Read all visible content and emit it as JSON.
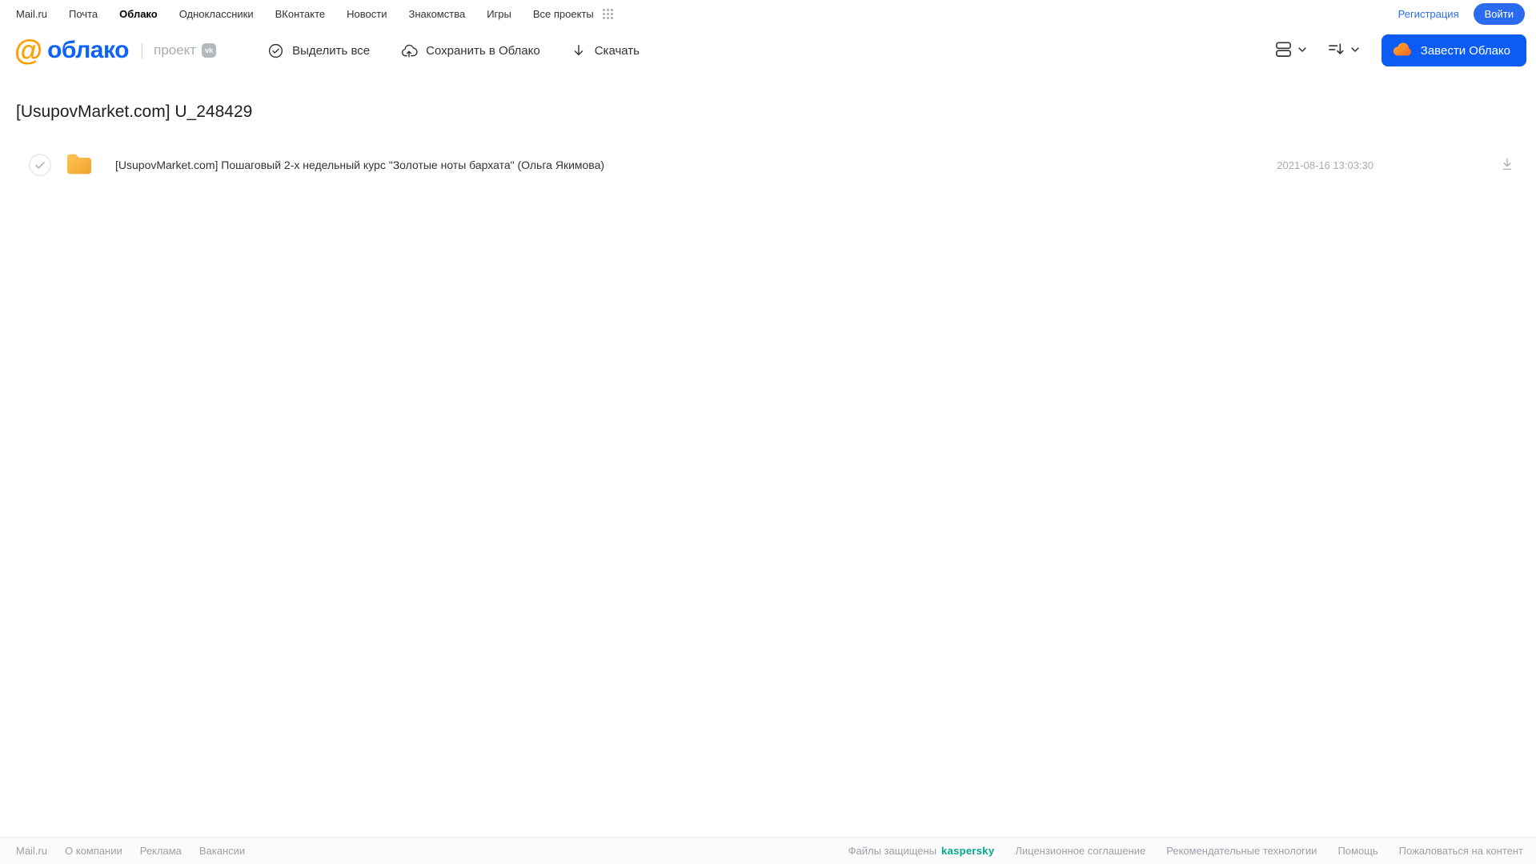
{
  "portal_nav": {
    "items": [
      "Mail.ru",
      "Почта",
      "Облако",
      "Одноклассники",
      "ВКонтакте",
      "Новости",
      "Знакомства",
      "Игры",
      "Все проекты"
    ],
    "active_item": "Облако",
    "registration_label": "Регистрация",
    "login_label": "Войти"
  },
  "header": {
    "logo_at": "@",
    "logo_text": "облако",
    "project_label": "проект",
    "vk_badge": "vk",
    "toolbar": {
      "select_all_label": "Выделить все",
      "save_to_cloud_label": "Сохранить в Облако",
      "download_label": "Скачать"
    },
    "get_cloud_label": "Завести Облако"
  },
  "page": {
    "title": "[UsupovMarket.com] U_248429"
  },
  "files": [
    {
      "type": "folder",
      "name": "[UsupovMarket.com] Пошаговый 2-х недельный курс \"Золотые ноты бархата\" (Ольга Якимова)",
      "date": "2021-08-16 13:03:30"
    }
  ],
  "footer": {
    "left_links": [
      "Mail.ru",
      "О компании",
      "Реклама",
      "Вакансии"
    ],
    "protected_label": "Файлы защищены",
    "kaspersky_label": "kaspersky",
    "right_links": [
      "Лицензионное соглашение",
      "Рекомендательные технологии",
      "Помощь",
      "Пожаловаться на контент"
    ]
  },
  "colors": {
    "brand_blue": "#0b5cf5",
    "link_blue": "#2b6cee",
    "logo_orange": "#ff9e00",
    "folder_yellow": "#f6ab3a",
    "kaspersky_green": "#00a88e",
    "text_dark": "#333333",
    "text_gray": "#9ba1a8"
  }
}
